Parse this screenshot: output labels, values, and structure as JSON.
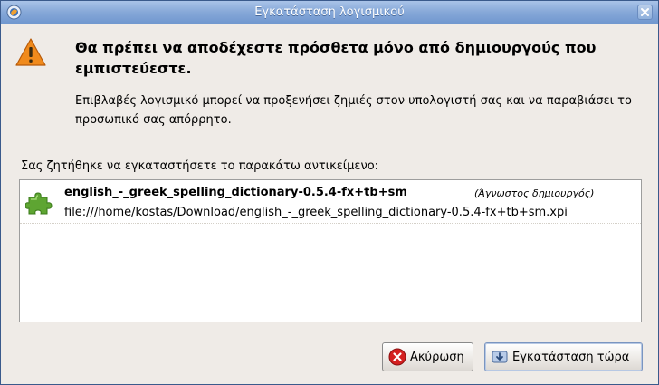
{
  "window": {
    "title": "Εγκατάσταση λογισμικού"
  },
  "warning": {
    "headline": "Θα πρέπει να αποδέχεστε πρόσθετα μόνο από δημιουργούς που εμπιστεύεστε.",
    "description": "Επιβλαβές λογισμικό μπορεί να προξενήσει ζημιές στον υπολογιστή σας και να παραβιάσει το προσωπικό σας απόρρητο."
  },
  "list": {
    "label": "Σας ζητήθηκε να εγκαταστήσετε το παρακάτω αντικείμενο:",
    "items": [
      {
        "name": "english_-_greek_spelling_dictionary-0.5.4-fx+tb+sm",
        "author": "(Άγνωστος δημιουργός)",
        "url": "file:///home/kostas/Download/english_-_greek_spelling_dictionary-0.5.4-fx+tb+sm.xpi",
        "icon": "puzzle-piece-icon"
      }
    ]
  },
  "buttons": {
    "cancel_label": "Ακύρωση",
    "install_label": "Εγκατάσταση τώρα"
  },
  "colors": {
    "titlebar": "#86a8d8",
    "warning_orange": "#f08a1c",
    "puzzle_green": "#5ea532",
    "cancel_red": "#d42020"
  }
}
